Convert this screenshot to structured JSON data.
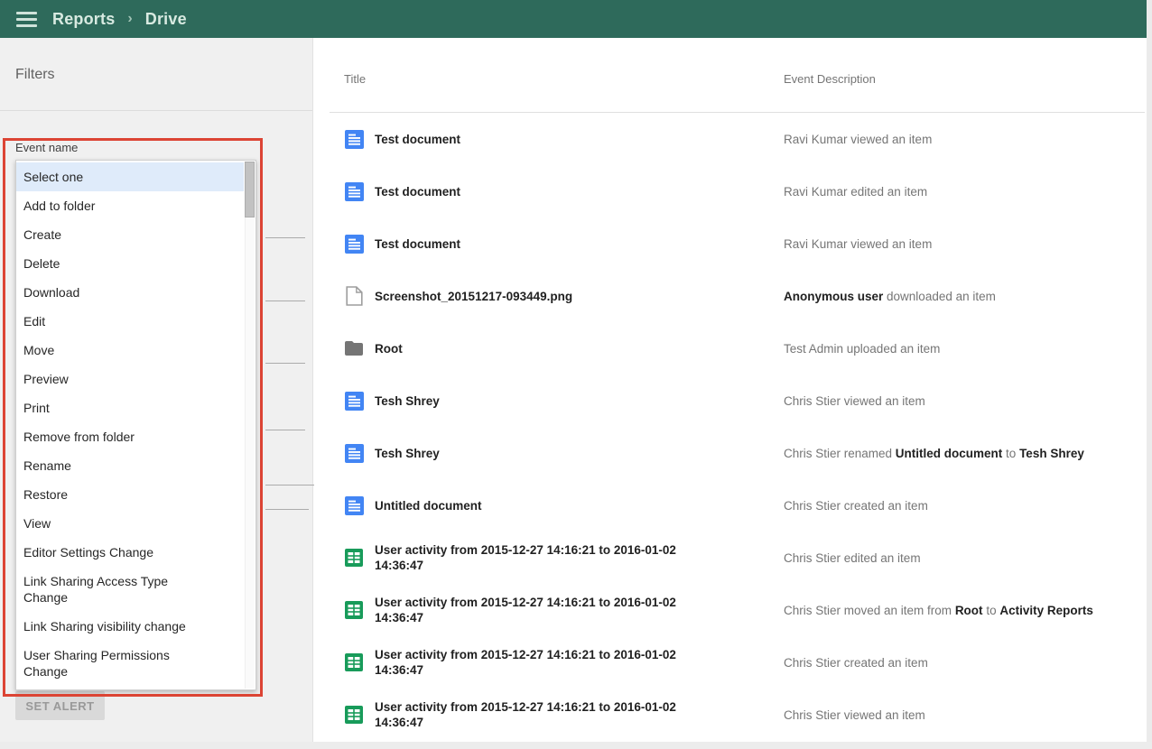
{
  "topbar": {
    "breadcrumb": [
      "Reports",
      "Drive"
    ],
    "separator": "›",
    "bg_color": "#2E6A5B"
  },
  "filters": {
    "title": "Filters",
    "event_name_label": "Event name",
    "selected_option": "Select one",
    "event_options": [
      "Select one",
      "Add to folder",
      "Create",
      "Delete",
      "Download",
      "Edit",
      "Move",
      "Preview",
      "Print",
      "Remove from folder",
      "Rename",
      "Restore",
      "View",
      "Editor Settings Change",
      "Link Sharing Access Type\nChange",
      "Link Sharing visibility change",
      "User Sharing Permissions\nChange"
    ],
    "set_alert_label": "SET ALERT"
  },
  "table": {
    "columns": [
      "Title",
      "Event Description"
    ],
    "rows": [
      {
        "icon": "docs-icon",
        "title": "Test document",
        "description": [
          {
            "text": "Ravi Kumar viewed an item",
            "bold": false
          }
        ]
      },
      {
        "icon": "docs-icon",
        "title": "Test document",
        "description": [
          {
            "text": "Ravi Kumar edited an item",
            "bold": false
          }
        ]
      },
      {
        "icon": "docs-icon",
        "title": "Test document",
        "description": [
          {
            "text": "Ravi Kumar viewed an item",
            "bold": false
          }
        ]
      },
      {
        "icon": "file-icon",
        "title": "Screenshot_20151217-093449.png",
        "description": [
          {
            "text": "Anonymous user",
            "bold": true
          },
          {
            "text": " downloaded an item",
            "bold": false
          }
        ]
      },
      {
        "icon": "folder-icon",
        "title": "Root",
        "description": [
          {
            "text": "Test Admin uploaded an item",
            "bold": false
          }
        ]
      },
      {
        "icon": "docs-icon",
        "title": "Tesh Shrey",
        "description": [
          {
            "text": "Chris Stier viewed an item",
            "bold": false
          }
        ]
      },
      {
        "icon": "docs-icon",
        "title": "Tesh Shrey",
        "description": [
          {
            "text": "Chris Stier renamed ",
            "bold": false
          },
          {
            "text": "Untitled document",
            "bold": true
          },
          {
            "text": " to ",
            "bold": false
          },
          {
            "text": "Tesh Shrey",
            "bold": true
          }
        ]
      },
      {
        "icon": "docs-icon",
        "title": "Untitled document",
        "description": [
          {
            "text": "Chris Stier created an item",
            "bold": false
          }
        ]
      },
      {
        "icon": "sheets-icon",
        "title": "User activity from 2015-12-27 14:16:21 to 2016-01-02\n14:36:47",
        "description": [
          {
            "text": "Chris Stier edited an item",
            "bold": false
          }
        ]
      },
      {
        "icon": "sheets-icon",
        "title": "User activity from 2015-12-27 14:16:21 to 2016-01-02\n14:36:47",
        "description": [
          {
            "text": "Chris Stier moved an item from ",
            "bold": false
          },
          {
            "text": "Root",
            "bold": true
          },
          {
            "text": " to ",
            "bold": false
          },
          {
            "text": "Activity Reports",
            "bold": true
          }
        ]
      },
      {
        "icon": "sheets-icon",
        "title": "User activity from 2015-12-27 14:16:21 to 2016-01-02\n14:36:47",
        "description": [
          {
            "text": "Chris Stier created an item",
            "bold": false
          }
        ]
      },
      {
        "icon": "sheets-icon",
        "title": "User activity from 2015-12-27 14:16:21 to 2016-01-02\n14:36:47",
        "description": [
          {
            "text": "Chris Stier viewed an item",
            "bold": false
          }
        ]
      }
    ]
  },
  "colors": {
    "header_bg": "#2E6A5B",
    "annotation_red": "#DC4434",
    "selected_option_bg": "#DFEBFA",
    "docs_blue": "#4285F4",
    "sheets_green": "#189B5A",
    "folder_gray": "#757575"
  }
}
